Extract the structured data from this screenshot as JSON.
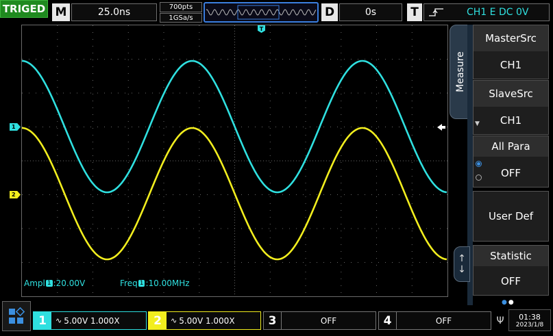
{
  "status": "TRIGED",
  "horizontal": {
    "label": "M",
    "value": "25.0ns"
  },
  "acquisition": {
    "points": "700pts",
    "rate": "1GSa/s"
  },
  "delay": {
    "label": "D",
    "value": "0s"
  },
  "trigger": {
    "label": "T",
    "value": "CH1 E DC 0V"
  },
  "trigger_marker": "T",
  "side_tab": "Measure",
  "menu": [
    {
      "title": "MasterSrc",
      "value": "CH1"
    },
    {
      "title": "SlaveSrc",
      "value": "CH1"
    },
    {
      "title": "All Para",
      "value": "OFF"
    },
    {
      "title": "User Def",
      "value": ""
    },
    {
      "title": "Statistic",
      "value": "OFF"
    }
  ],
  "measurements": {
    "amp_label": "Ampl",
    "amp_ch": "1",
    "amp_value": ":20.00V",
    "freq_label": "Freq",
    "freq_ch": "1",
    "freq_value": ":10.00MHz"
  },
  "channels": [
    {
      "num": "1",
      "text": "5.00V 1.000X",
      "color": "#2fe0e0"
    },
    {
      "num": "2",
      "text": "5.00V 1.000X",
      "color": "#f2ee1e"
    },
    {
      "num": "3",
      "text": "OFF"
    },
    {
      "num": "4",
      "text": "OFF"
    }
  ],
  "ch_markers": [
    "1",
    "2"
  ],
  "clock": {
    "time": "01:38",
    "date": "2023/1/8"
  },
  "waveforms": {
    "periods_on_screen": 2.5,
    "ch1": {
      "color": "#2fe0e0"
    },
    "ch2": {
      "color": "#f2ee1e"
    }
  }
}
